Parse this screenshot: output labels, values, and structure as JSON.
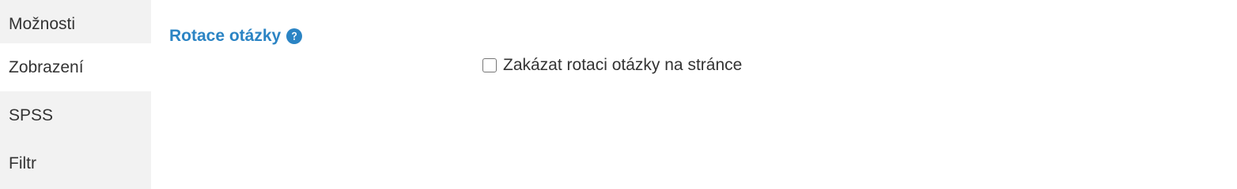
{
  "sidebar": {
    "items": [
      {
        "label": "Možnosti",
        "active": false
      },
      {
        "label": "Zobrazení",
        "active": true
      },
      {
        "label": "SPSS",
        "active": false
      },
      {
        "label": "Filtr",
        "active": false
      }
    ]
  },
  "main": {
    "section_title": "Rotace otázky",
    "help_icon": "question-circle-icon",
    "option": {
      "label": "Zakázat rotaci otázky na stránce",
      "checked": false
    }
  },
  "colors": {
    "accent": "#2b84c4",
    "sidebar_bg": "#f2f2f2",
    "active_bg": "#ffffff",
    "text": "#333333"
  }
}
